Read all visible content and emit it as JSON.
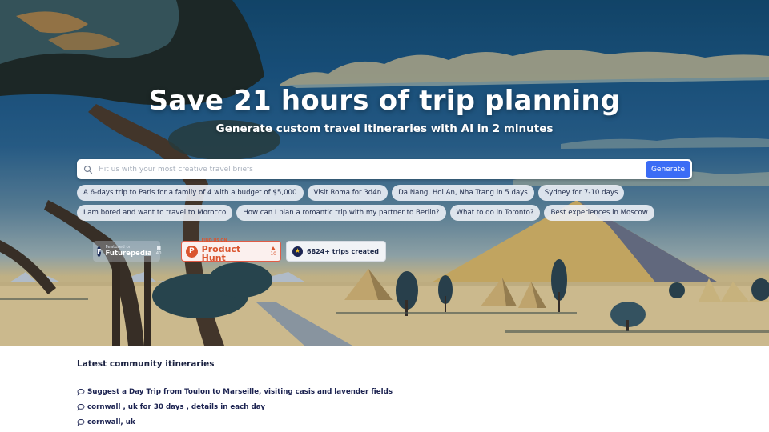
{
  "hero": {
    "headline": "Save 21 hours of trip planning",
    "subheadline": "Generate custom travel itineraries with AI in 2 minutes",
    "background_icon": "landscape-pyramids-illustration"
  },
  "search": {
    "icon": "search-icon",
    "placeholder": "Hit us with your most creative travel briefs",
    "value": "",
    "button_label": "Generate"
  },
  "suggestions": {
    "row1": [
      "A 6-days trip to Paris for a family of 4 with a budget of $5,000",
      "Visit Roma for 3d4n",
      "Da Nang, Hoi An, Nha Trang in 5 days",
      "Sydney for 7-10 days"
    ],
    "row2": [
      "I am bored and want to travel to Morocco",
      "How can I plan a romantic trip with my partner to Berlin?",
      "What to do in Toronto?",
      "Best experiences in Moscow"
    ]
  },
  "badges": {
    "futurepedia": {
      "logo_letter": "F",
      "caption": "Featured on",
      "name": "Futurepedia",
      "count": "40"
    },
    "product_hunt": {
      "logo_letter": "P",
      "caption": "FIND US ON",
      "name": "Product Hunt",
      "count": "10"
    },
    "trips": {
      "icon": "star-icon",
      "label": "6824+ trips created"
    }
  },
  "community": {
    "title": "Latest community itineraries",
    "item_icon": "speech-bubble-icon",
    "items": [
      "Suggest a Day Trip from Toulon to Marseille, visiting casis and lavender fields",
      "cornwall , uk for 30 days , details in each day",
      "cornwall, uk"
    ]
  },
  "colors": {
    "primary_button": "#3b6cf5",
    "product_hunt": "#da552f",
    "text_dark": "#1c2351",
    "star": "#f6c41a"
  }
}
